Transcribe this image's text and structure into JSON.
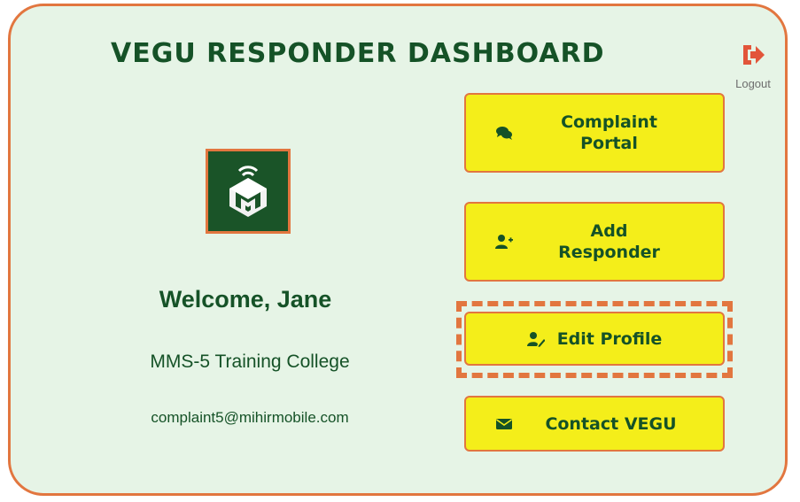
{
  "header": {
    "title": "VEGU RESPONDER DASHBOARD",
    "logout_label": "Logout",
    "logout_icon": "logout-icon"
  },
  "profile": {
    "logo_icon": "vegu-logo",
    "welcome": "Welcome, Jane",
    "organization": "MMS-5 Training College",
    "email": "complaint5@mihirmobile.com"
  },
  "actions": [
    {
      "label": "Complaint\nPortal",
      "icon": "comments-icon"
    },
    {
      "label": "Add\nResponder",
      "icon": "user-plus-icon"
    },
    {
      "label": "Edit Profile",
      "icon": "user-edit-icon",
      "highlighted": true
    },
    {
      "label": "Contact VEGU",
      "icon": "envelope-icon"
    }
  ],
  "colors": {
    "brand_green": "#155227",
    "logo_bg": "#1a5428",
    "accent_orange": "#e2763f",
    "button_yellow": "#f4ee1a",
    "card_bg": "#e6f4e6"
  }
}
